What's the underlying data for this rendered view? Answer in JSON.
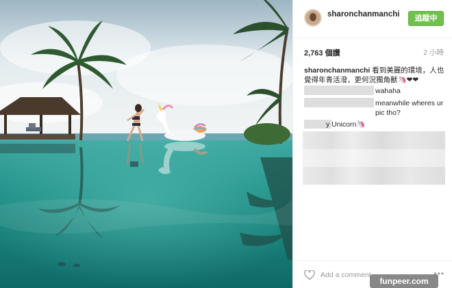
{
  "post": {
    "username": "sharonchanmanchi",
    "follow_label": "追蹤中",
    "views": "2,763 個讚",
    "time": "2 小時",
    "caption_user": "sharonchanmanchi",
    "caption_text": "看到美麗的環境，人也覺得年青活潑，更何況獨角獸🦄❤❤"
  },
  "comments": [
    {
      "text": "wahaha"
    },
    {
      "text": "meanwhile wheres ur pic tho?"
    },
    {
      "text": "y Unicorn🦄"
    }
  ],
  "footer": {
    "add_comment_placeholder": "Add a comment…",
    "more_label": "•••"
  },
  "watermark": "funpeer.com",
  "colors": {
    "follow_button": "#70c050",
    "water": "#1f8f86",
    "sky": "#dfe9ee"
  },
  "icons": [
    "heart-icon",
    "more-icon",
    "avatar"
  ]
}
